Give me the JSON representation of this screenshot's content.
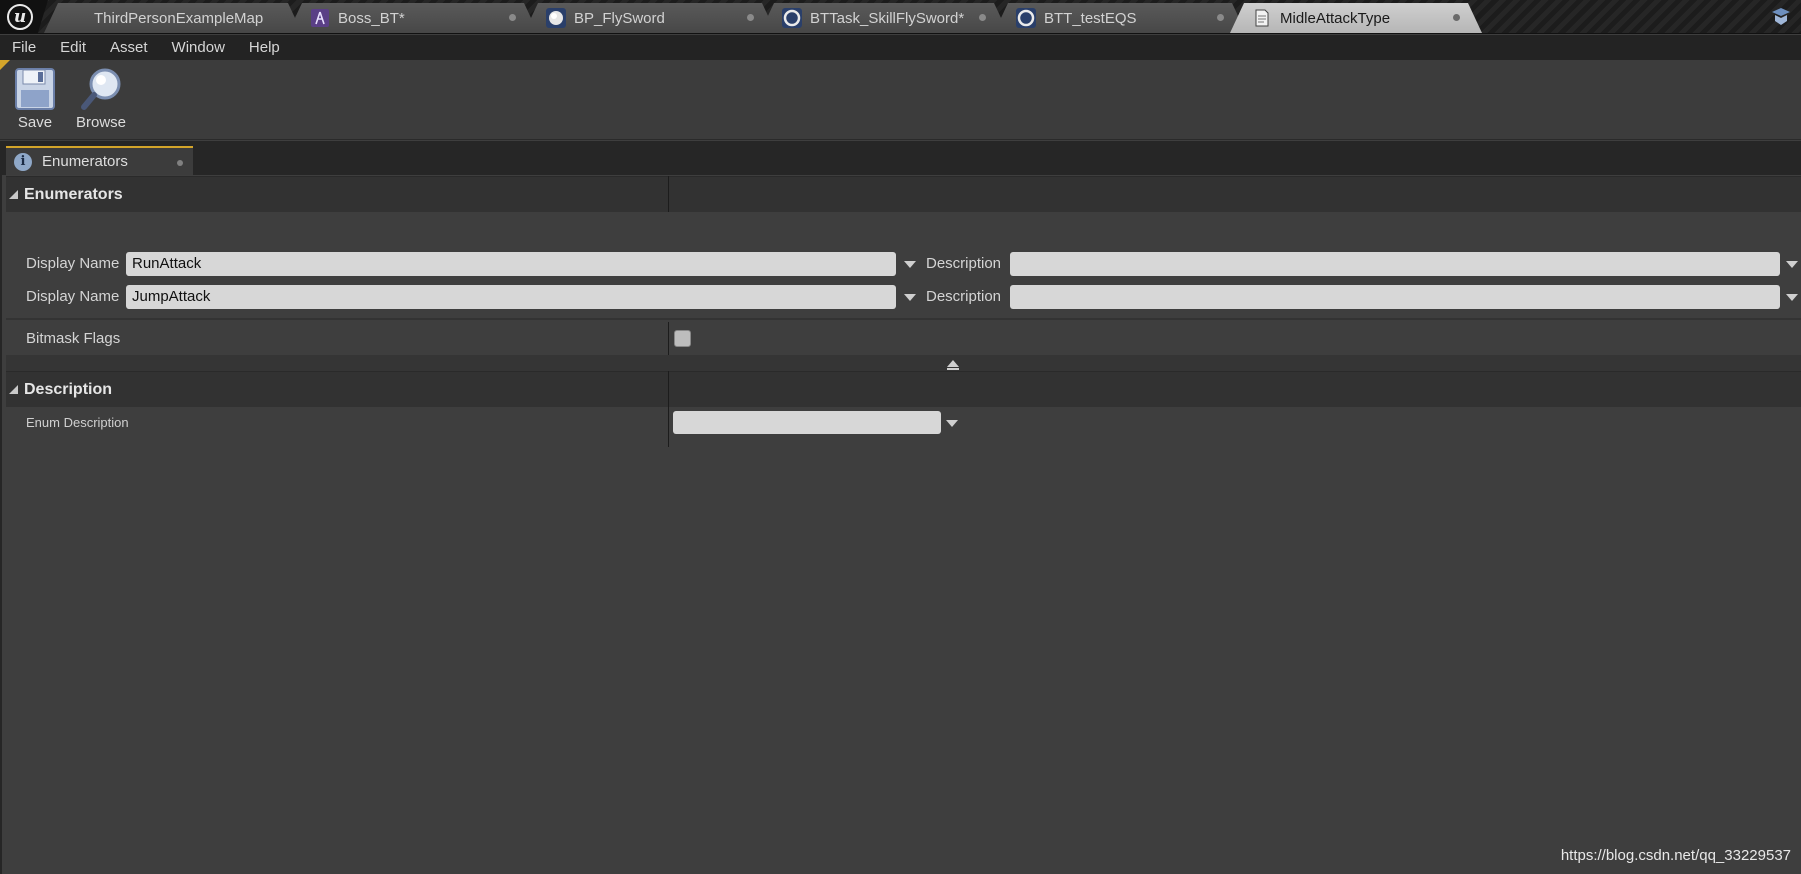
{
  "tabs": [
    {
      "label": "ThirdPersonExampleMap",
      "icon": "level-icon",
      "active": false
    },
    {
      "label": "Boss_BT*",
      "icon": "behavior-tree-icon",
      "active": false
    },
    {
      "label": "BP_FlySword",
      "icon": "blueprint-sphere-icon",
      "active": false
    },
    {
      "label": "BTTask_SkillFlySword*",
      "icon": "bt-task-icon",
      "active": false
    },
    {
      "label": "BTT_testEQS",
      "icon": "bt-task-icon",
      "active": false
    },
    {
      "label": "MidleAttackType",
      "icon": "enum-document-icon",
      "active": true
    }
  ],
  "menu": [
    "File",
    "Edit",
    "Asset",
    "Window",
    "Help"
  ],
  "toolbar": {
    "save_label": "Save",
    "browse_label": "Browse"
  },
  "panel_tab": {
    "label": "Enumerators"
  },
  "sections": {
    "enumerators": {
      "title": "Enumerators",
      "rows": [
        {
          "display_label": "Display Name",
          "display_value": "RunAttack",
          "desc_label": "Description",
          "desc_value": ""
        },
        {
          "display_label": "Display Name",
          "display_value": "JumpAttack",
          "desc_label": "Description",
          "desc_value": ""
        }
      ],
      "bitmask_label": "Bitmask Flags"
    },
    "description": {
      "title": "Description",
      "enum_desc_label": "Enum Description",
      "enum_desc_value": ""
    }
  },
  "watermark": "https://blog.csdn.net/qq_33229537",
  "colors": {
    "accent": "#d4a52a",
    "panel_bg": "#3e3e3e",
    "field_bg": "#d7d7d7"
  }
}
